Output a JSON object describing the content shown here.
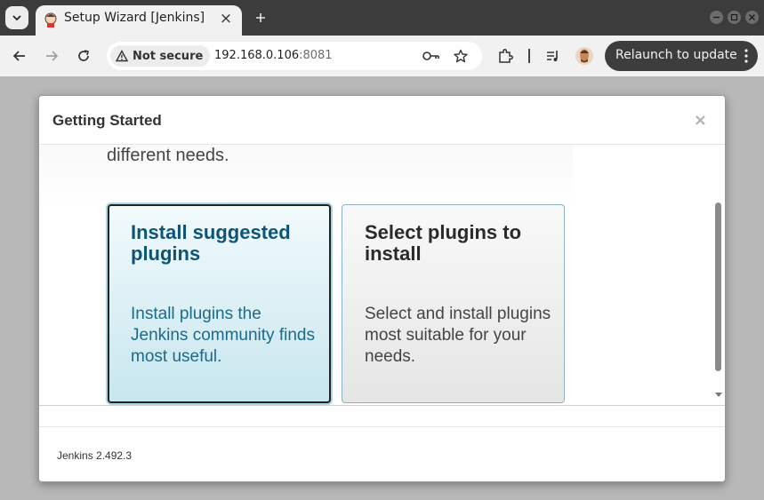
{
  "browser": {
    "tab": {
      "title": "Setup Wizard [Jenkins]"
    },
    "toolbar": {
      "security_label": "Not secure",
      "url_host": "192.168.0.106",
      "url_port": ":8081",
      "relaunch_label": "Relaunch to update"
    }
  },
  "modal": {
    "title": "Getting Started",
    "close_glyph": "×",
    "intro_tail": "different needs.",
    "cards": [
      {
        "title": "Install suggested plugins",
        "description": "Install plugins the Jenkins community finds most useful."
      },
      {
        "title": "Select plugins to install",
        "description": "Select and install plugins most suitable for your needs."
      }
    ],
    "footer_version": "Jenkins 2.492.3"
  },
  "colors": {
    "tabbar": "#3c3c3c",
    "toolbar": "#f1f1f1",
    "suggested_title": "#0e5575",
    "suggested_bg": "#c7e6ee",
    "select_bg": "#e5e5e5"
  },
  "icons": {
    "tab_search": "chevron-down-icon",
    "new_tab": "plus-icon",
    "back": "arrow-left-icon",
    "forward": "arrow-right-icon",
    "reload": "reload-icon",
    "security": "warning-triangle-icon",
    "password": "key-icon",
    "bookmark": "star-icon",
    "extensions": "puzzle-icon",
    "media": "media-control-icon",
    "menu": "kebab-icon"
  }
}
